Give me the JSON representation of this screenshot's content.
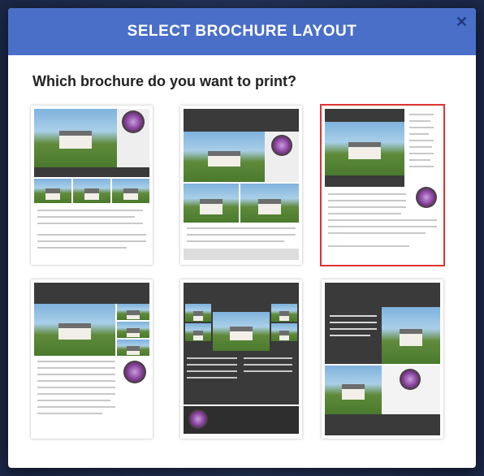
{
  "modal": {
    "title": "SELECT BROCHURE LAYOUT",
    "question": "Which brochure do you want to print?",
    "close_icon": "close-icon"
  },
  "layouts": [
    {
      "id": 1,
      "selected": false
    },
    {
      "id": 2,
      "selected": false
    },
    {
      "id": 3,
      "selected": true
    },
    {
      "id": 4,
      "selected": false
    },
    {
      "id": 5,
      "selected": false
    },
    {
      "id": 6,
      "selected": false
    }
  ],
  "accent": "#4a6fc9",
  "selected_color": "#dd3333"
}
